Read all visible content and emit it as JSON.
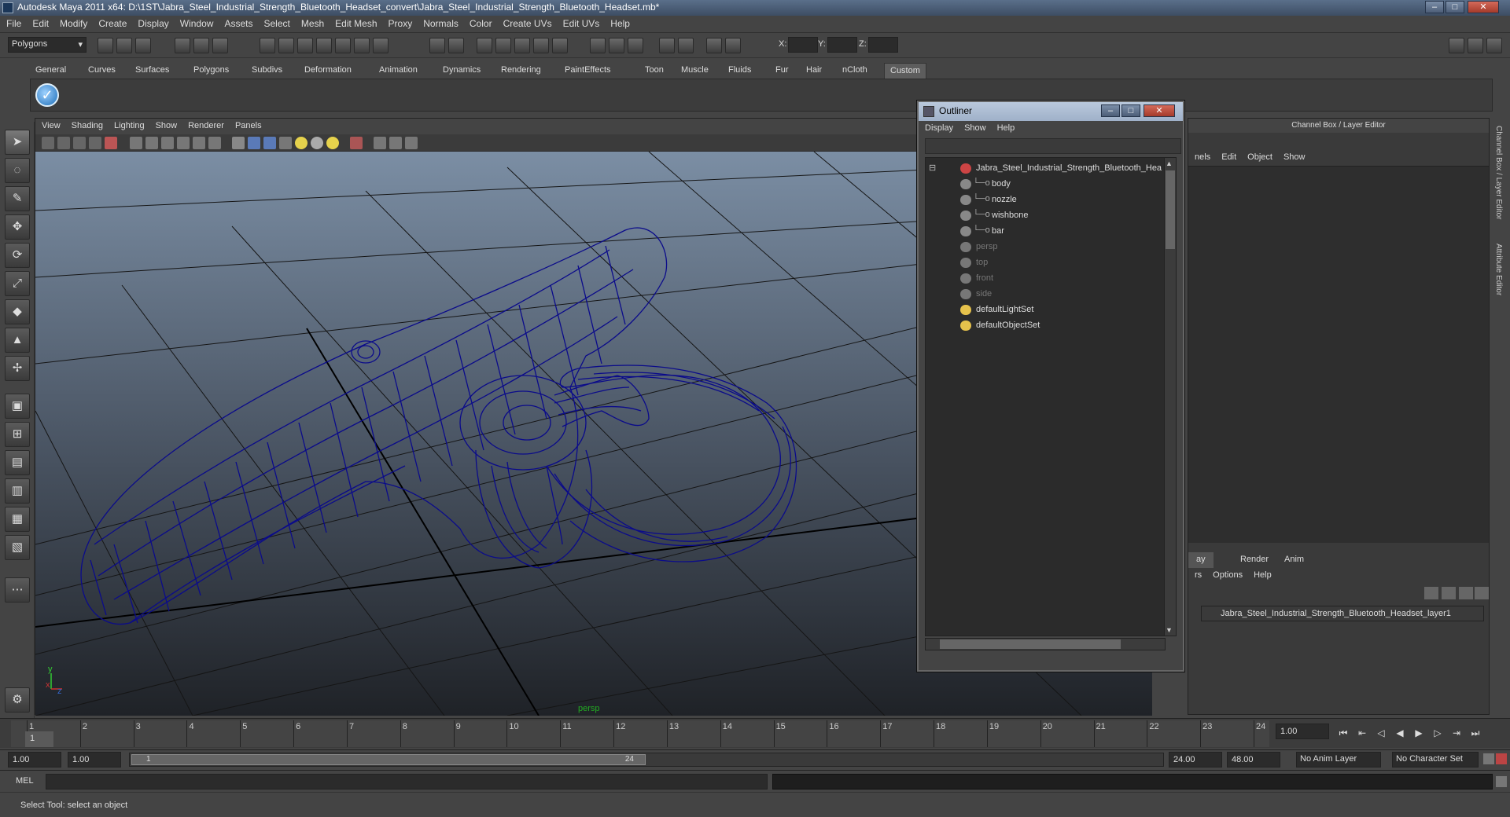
{
  "window": {
    "title": "Autodesk Maya 2011 x64: D:\\1ST\\Jabra_Steel_Industrial_Strength_Bluetooth_Headset_convert\\Jabra_Steel_Industrial_Strength_Bluetooth_Headset.mb*"
  },
  "menubar": [
    "File",
    "Edit",
    "Modify",
    "Create",
    "Display",
    "Window",
    "Assets",
    "Select",
    "Mesh",
    "Edit Mesh",
    "Proxy",
    "Normals",
    "Color",
    "Create UVs",
    "Edit UVs",
    "Help"
  ],
  "statusline": {
    "mode": "Polygons",
    "x_label": "X:",
    "y_label": "Y:",
    "z_label": "Z:"
  },
  "shelf_tabs": [
    {
      "label": "General"
    },
    {
      "label": "Curves"
    },
    {
      "label": "Surfaces"
    },
    {
      "label": "Polygons"
    },
    {
      "label": "Subdivs"
    },
    {
      "label": "Deformation"
    },
    {
      "label": "Animation"
    },
    {
      "label": "Dynamics"
    },
    {
      "label": "Rendering"
    },
    {
      "label": "PaintEffects"
    },
    {
      "label": "Toon"
    },
    {
      "label": "Muscle"
    },
    {
      "label": "Fluids"
    },
    {
      "label": "Fur"
    },
    {
      "label": "Hair"
    },
    {
      "label": "nCloth"
    },
    {
      "label": "Custom"
    }
  ],
  "shelf_button_glyph": "✓",
  "viewport": {
    "menu": [
      "View",
      "Shading",
      "Lighting",
      "Show",
      "Renderer",
      "Panels"
    ],
    "camera_label": "persp",
    "axis_y": "y",
    "axis_x": "x",
    "axis_z": "z"
  },
  "outliner": {
    "title": "Outliner",
    "menu": [
      "Display",
      "Show",
      "Help"
    ],
    "rows": [
      {
        "label": "Jabra_Steel_Industrial_Strength_Bluetooth_Headset",
        "kind": "group",
        "dim": false
      },
      {
        "label": "body",
        "kind": "mesh",
        "dim": false
      },
      {
        "label": "nozzle",
        "kind": "mesh",
        "dim": false
      },
      {
        "label": "wishbone",
        "kind": "mesh",
        "dim": false
      },
      {
        "label": "bar",
        "kind": "mesh",
        "dim": false
      },
      {
        "label": "persp",
        "kind": "camera",
        "dim": true
      },
      {
        "label": "top",
        "kind": "camera",
        "dim": true
      },
      {
        "label": "front",
        "kind": "camera",
        "dim": true
      },
      {
        "label": "side",
        "kind": "camera",
        "dim": true
      },
      {
        "label": "defaultLightSet",
        "kind": "set",
        "dim": false
      },
      {
        "label": "defaultObjectSet",
        "kind": "set",
        "dim": false
      }
    ]
  },
  "channel_box": {
    "header": "Channel Box / Layer Editor",
    "menu": [
      "nels",
      "Edit",
      "Object",
      "Show"
    ],
    "layer_tabs": [
      "ay",
      "Render",
      "Anim"
    ],
    "layer_menu": [
      "rs",
      "Options",
      "Help"
    ],
    "layer_name": "Jabra_Steel_Industrial_Strength_Bluetooth_Headset_layer1"
  },
  "right_strip": {
    "channel_tab": "Channel Box / Layer Editor",
    "attr_tab": "Attribute Editor"
  },
  "timeslider": {
    "ticks": [
      "1",
      "2",
      "3",
      "4",
      "5",
      "6",
      "7",
      "8",
      "9",
      "10",
      "11",
      "12",
      "13",
      "14",
      "15",
      "16",
      "17",
      "18",
      "19",
      "20",
      "21",
      "22",
      "23",
      "24"
    ],
    "current_frame": "1.00",
    "playhead_label": "1"
  },
  "rangeslider": {
    "start": "1.00",
    "playback_start": "1.00",
    "thumb_start": "1",
    "thumb_end": "24",
    "playback_end": "24.00",
    "end": "48.00",
    "anim_layer": "No Anim Layer",
    "character_set": "No Character Set"
  },
  "cmdline": {
    "label": "MEL"
  },
  "helpline": {
    "text": "Select Tool: select an object"
  }
}
